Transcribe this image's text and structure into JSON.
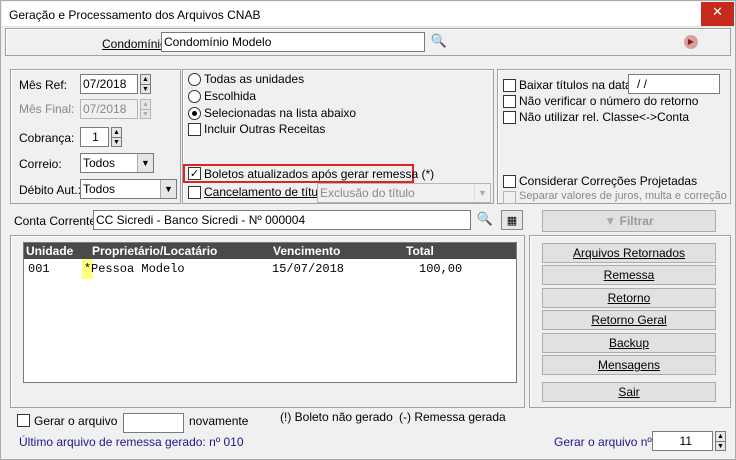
{
  "window": {
    "title": "Geração e Processamento dos Arquivos CNAB",
    "close_glyph": "✕"
  },
  "condominio": {
    "label": "Condomínio:",
    "value": "Condomínio Modelo"
  },
  "left_panel": {
    "mes_ref": {
      "label": "Mês Ref:",
      "value": "07/2018"
    },
    "mes_final": {
      "label": "Mês Final:",
      "value": "07/2018"
    },
    "cobranca": {
      "label": "Cobrança:",
      "value": "1"
    },
    "correio": {
      "label": "Correio:",
      "value": "Todos"
    },
    "debito_aut": {
      "label": "Débito Aut.:",
      "value": "Todos"
    }
  },
  "middle_panel": {
    "radio_todas": "Todas as unidades",
    "radio_escolhida": "Escolhida",
    "radio_selecionadas": "Selecionadas na lista abaixo",
    "check_outras_receitas": "Incluir Outras Receitas",
    "check_boletos": "Boletos atualizados após gerar remessa (*)",
    "check_cancelamento": "Cancelamento de título",
    "cancelamento_combo": "Exclusão do título"
  },
  "right_panel": {
    "check_baixar": "Baixar títulos na data:",
    "baixar_date": " / /",
    "check_nao_verificar": "Não verificar o número do retorno",
    "check_nao_utilizar": "Não utilizar rel. Classe<->Conta",
    "check_considerar": "Considerar Correções Projetadas",
    "check_separar": "Separar valores de juros, multa e correção"
  },
  "conta_corrente": {
    "label": "Conta Corrente:",
    "value": "CC Sicredi - Banco Sicredi - Nº 000004"
  },
  "filtrar_label": "Filtrar",
  "grid": {
    "headers": [
      "Unidade",
      "Proprietário/Locatário",
      "Vencimento",
      "Total"
    ],
    "rows": [
      {
        "unidade": "001",
        "marker": "*",
        "nome": "Pessoa Modelo",
        "vencimento": "15/07/2018",
        "total": "100,00"
      }
    ]
  },
  "buttons": {
    "arquivos_retornados": "Arquivos Retornados",
    "remessa": "Remessa",
    "retorno": "Retorno",
    "retorno_geral": "Retorno Geral",
    "backup": "Backup",
    "mensagens": "Mensagens",
    "sair": "Sair"
  },
  "bottom": {
    "gerar_arquivo_label": "Gerar o arquivo",
    "gerar_arquivo_value": "",
    "novamente": "novamente",
    "legend_boleto": "(!) Boleto não gerado",
    "legend_remessa": "(-) Remessa gerada",
    "ultimo_arquivo": "Último arquivo de remessa gerado: nº 010",
    "gerar_numero_label": "Gerar o arquivo nº:",
    "gerar_numero_value": "11"
  },
  "colors": {
    "highlight_border": "#d9262c",
    "marker_bg": "#ffff80",
    "grid_header": "#4a4a4a",
    "status_text": "#1a1a8c"
  }
}
